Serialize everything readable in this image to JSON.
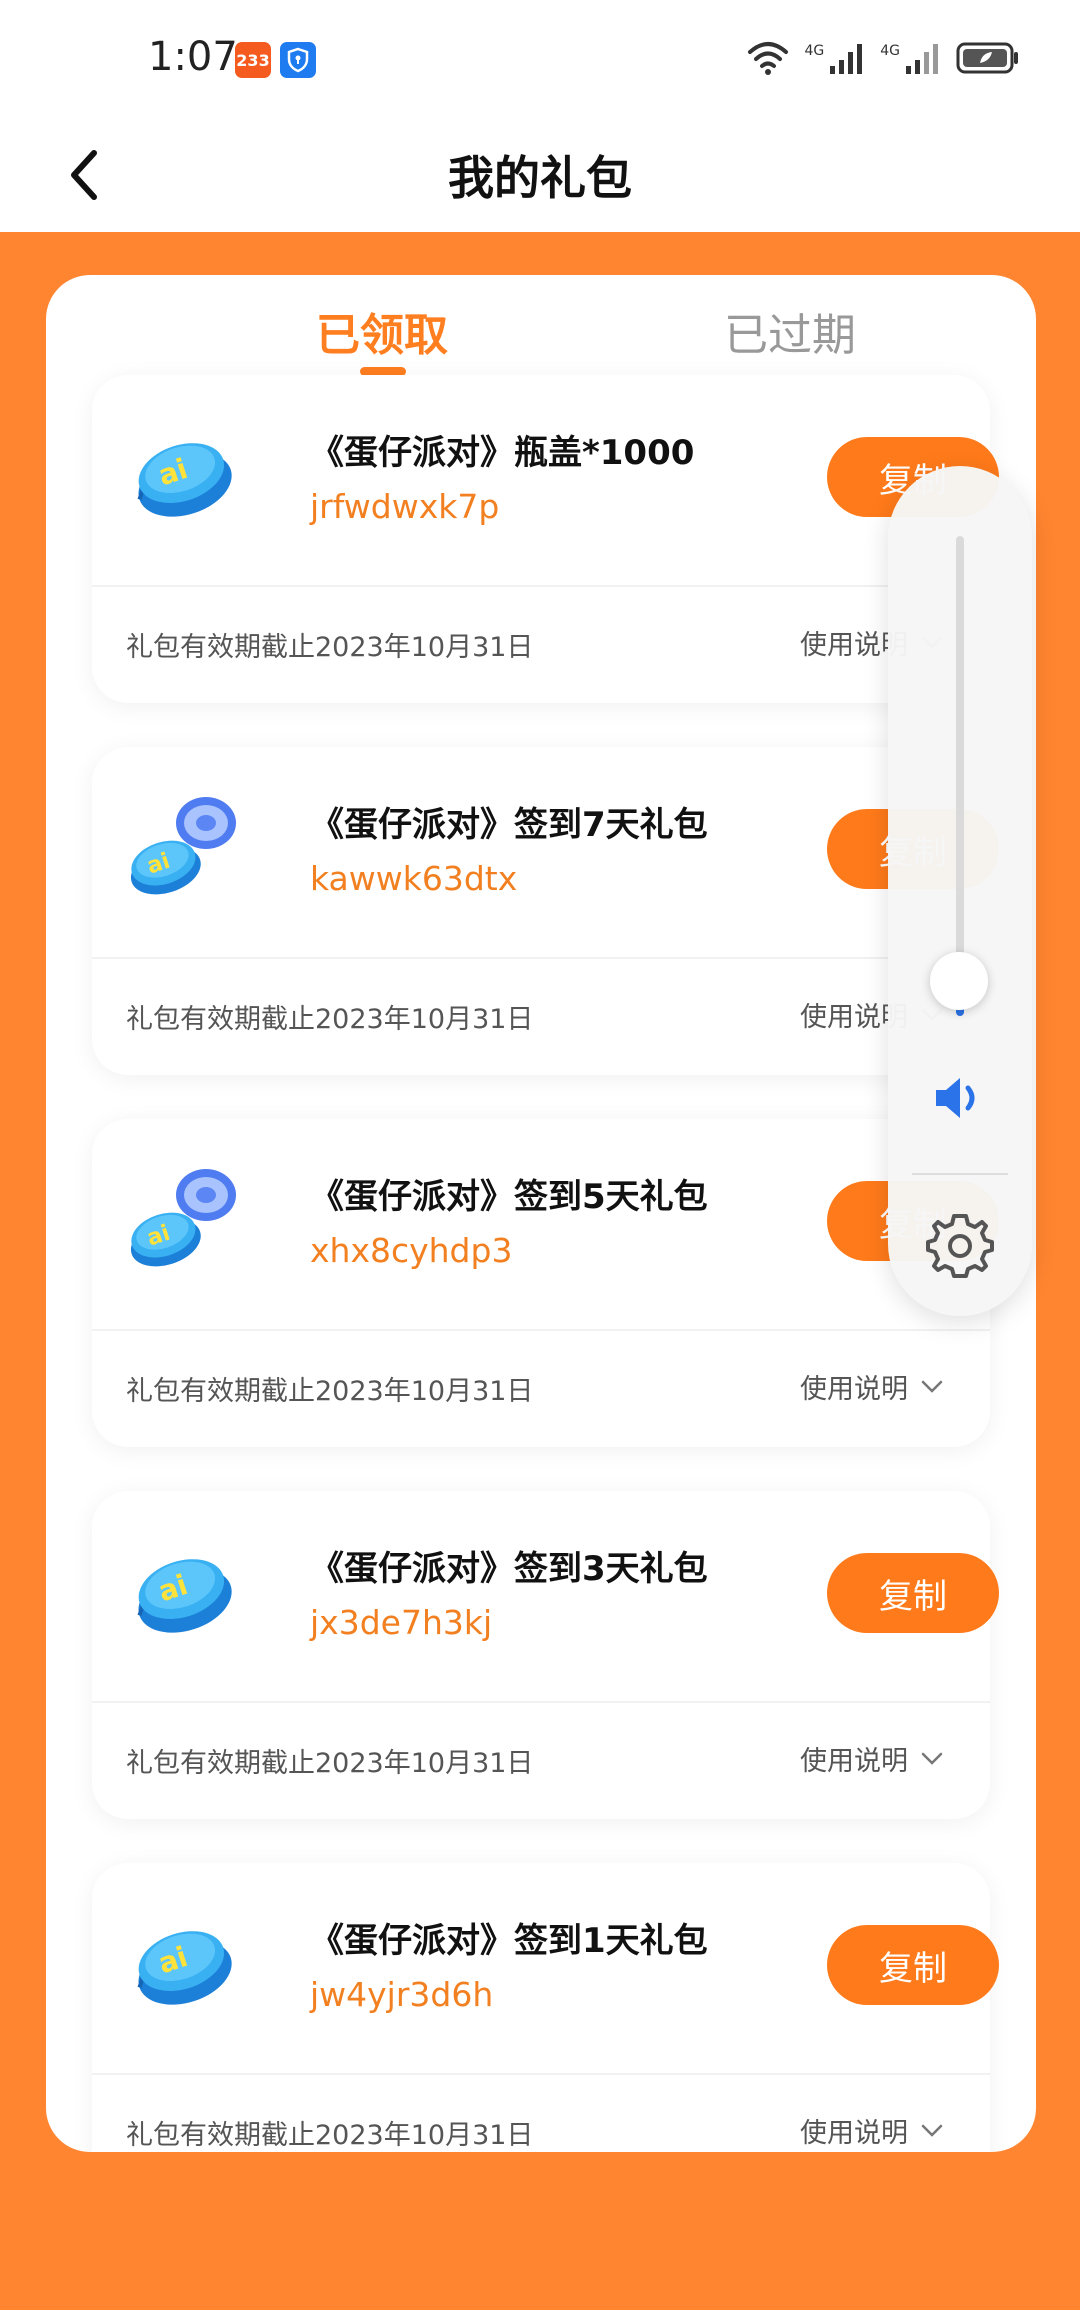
{
  "status_bar": {
    "time": "1:07",
    "badge_text": "233",
    "network_label_1": "4G",
    "network_label_2": "4G"
  },
  "header": {
    "title": "我的礼包"
  },
  "tabs": [
    {
      "label": "已领取",
      "active": true
    },
    {
      "label": "已过期",
      "active": false
    }
  ],
  "gifts": [
    {
      "title": "《蛋仔派对》瓶盖*1000",
      "code": "jrfwdwxk7p",
      "copy_label": "复制",
      "validity": "礼包有效期截止2023年10月31日",
      "usage_label": "使用说明",
      "icon": "bottle-cap-icon"
    },
    {
      "title": "《蛋仔派对》签到7天礼包",
      "code": "kawwk63dtx",
      "copy_label": "复制",
      "validity": "礼包有效期截止2023年10月31日",
      "usage_label": "使用说明",
      "icon": "bottle-cap-capsule-icon"
    },
    {
      "title": "《蛋仔派对》签到5天礼包",
      "code": "xhx8cyhdp3",
      "copy_label": "复制",
      "validity": "礼包有效期截止2023年10月31日",
      "usage_label": "使用说明",
      "icon": "bottle-cap-capsule-icon"
    },
    {
      "title": "《蛋仔派对》签到3天礼包",
      "code": "jx3de7h3kj",
      "copy_label": "复制",
      "validity": "礼包有效期截止2023年10月31日",
      "usage_label": "使用说明",
      "icon": "bottle-cap-icon"
    },
    {
      "title": "《蛋仔派对》签到1天礼包",
      "code": "jw4yjr3d6h",
      "copy_label": "复制",
      "validity": "礼包有效期截止2023年10月31日",
      "usage_label": "使用说明",
      "icon": "bottle-cap-icon"
    }
  ],
  "volume_overlay": {
    "level": 0.04,
    "speaker_icon": "speaker-icon",
    "settings_icon": "gear-icon"
  },
  "colors": {
    "accent": "#FF7A1A",
    "background": "#FF8530",
    "code_text": "#F28020"
  }
}
